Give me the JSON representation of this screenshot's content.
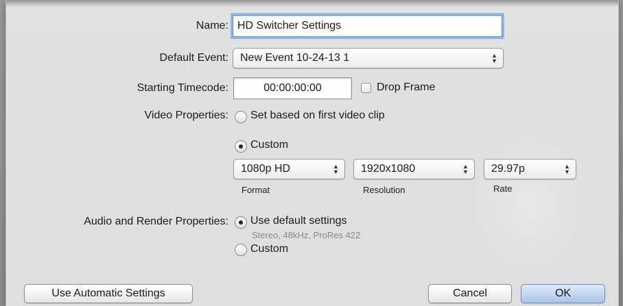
{
  "form": {
    "name_label": "Name:",
    "name_value": "HD Switcher Settings",
    "default_event_label": "Default Event:",
    "default_event_value": "New Event 10-24-13 1",
    "starting_timecode_label": "Starting Timecode:",
    "starting_timecode_value": "00:00:00:00",
    "drop_frame_label": "Drop Frame",
    "drop_frame_checked": false,
    "video_properties_label": "Video Properties:",
    "video_option_first_clip": "Set based on first video clip",
    "video_option_custom": "Custom",
    "video_selected": "Custom",
    "format_value": "1080p HD",
    "format_caption": "Format",
    "resolution_value": "1920x1080",
    "resolution_caption": "Resolution",
    "rate_value": "29.97p",
    "rate_caption": "Rate",
    "audio_render_label": "Audio and Render Properties:",
    "audio_option_default": "Use default settings",
    "audio_default_hint": "Stereo, 48kHz, ProRes 422",
    "audio_option_custom": "Custom",
    "audio_selected": "Use default settings"
  },
  "buttons": {
    "use_automatic": "Use Automatic Settings",
    "cancel": "Cancel",
    "ok": "OK"
  },
  "icons": {
    "updown_arrows": "▲▼"
  }
}
